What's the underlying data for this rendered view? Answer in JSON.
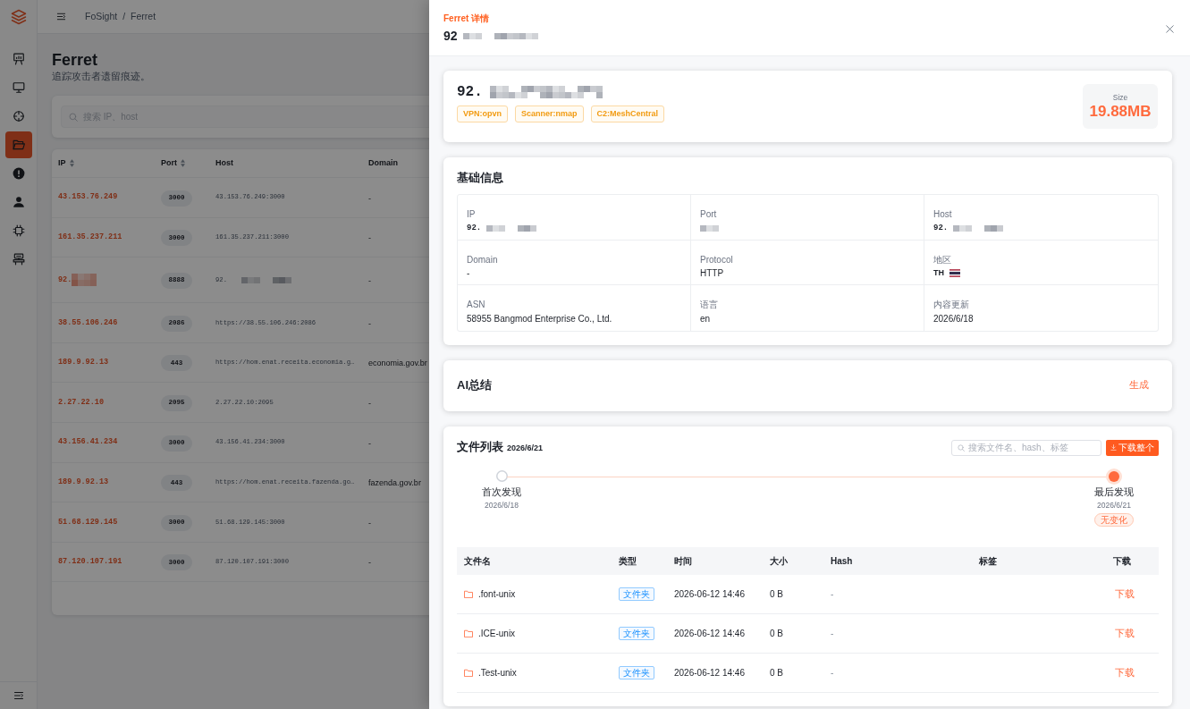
{
  "app": {
    "sidebar": {
      "items": [
        {
          "selected": false
        },
        {
          "selected": false
        },
        {
          "selected": false
        },
        {
          "selected": true
        },
        {
          "selected": false
        },
        {
          "selected": false
        },
        {
          "selected": false
        },
        {
          "selected": false
        }
      ]
    },
    "breadcrumb": {
      "items": [
        "FoSight",
        "Ferret"
      ],
      "separator": "/"
    },
    "page": {
      "title": "Ferret",
      "subtitle": "追踪攻击者遗留痕迹。"
    },
    "search": {
      "placeholder": "搜索 IP、host"
    },
    "table": {
      "columns": [
        {
          "label": "IP",
          "sortable": true
        },
        {
          "label": "Port",
          "sortable": true
        },
        {
          "label": "Host",
          "sortable": false
        },
        {
          "label": "Domain",
          "sortable": false
        }
      ],
      "rows": [
        {
          "ip": "43.153.76.249",
          "port": "3000",
          "host": "43.153.76.249:3000",
          "domain": "-",
          "redacted": false
        },
        {
          "ip": "161.35.237.211",
          "port": "3000",
          "host": "161.35.237.211:3000",
          "domain": "-",
          "redacted": false
        },
        {
          "ip": "92.",
          "port": "8888",
          "host": "92.",
          "domain": "-",
          "redacted": true
        },
        {
          "ip": "38.55.106.246",
          "port": "2086",
          "host": "https://38.55.106.246:2086",
          "domain": "-",
          "redacted": false
        },
        {
          "ip": "189.9.92.13",
          "port": "443",
          "host": "https://hom.enat.receita.economia.g…",
          "domain": "economia.gov.br",
          "redacted": false
        },
        {
          "ip": "2.27.22.10",
          "port": "2095",
          "host": "2.27.22.10:2095",
          "domain": "-",
          "redacted": false
        },
        {
          "ip": "43.156.41.234",
          "port": "3000",
          "host": "43.156.41.234:3000",
          "domain": "-",
          "redacted": false
        },
        {
          "ip": "189.9.92.13",
          "port": "443",
          "host": "https://hom.enat.receita.fazenda.go…",
          "domain": "fazenda.gov.br",
          "redacted": false
        },
        {
          "ip": "51.68.129.145",
          "port": "3000",
          "host": "51.68.129.145:3000",
          "domain": "-",
          "redacted": false
        },
        {
          "ip": "87.120.107.191",
          "port": "3000",
          "host": "87.120.107.191:3000",
          "domain": "-",
          "redacted": false
        }
      ]
    }
  },
  "drawer": {
    "eyebrow": "Ferret 详情",
    "title": {
      "text": "92",
      "redacted": true
    },
    "summary": {
      "ip": {
        "text": "92.",
        "redacted": true
      },
      "tags": [
        "VPN:opvn",
        "Scanner:nmap",
        "C2:MeshCentral"
      ],
      "size": {
        "label": "Size",
        "value": "19.88MB"
      }
    },
    "basic_info": {
      "title": "基础信息",
      "fields": [
        {
          "label": "IP",
          "kind": "mono",
          "value": "92.",
          "redacted": true
        },
        {
          "label": "Port",
          "kind": "mono",
          "redacted": true
        },
        {
          "label": "Host",
          "kind": "mono",
          "value": "92.",
          "redacted": true
        },
        {
          "label": "Domain",
          "kind": "text",
          "value": "-",
          "redacted": false
        },
        {
          "label": "Protocol",
          "kind": "text",
          "value": "HTTP",
          "redacted": false
        },
        {
          "label": "地区",
          "kind": "country",
          "value": "TH",
          "redacted": false
        },
        {
          "label": "ASN",
          "kind": "text",
          "value": "58955 Bangmod Enterprise Co., Ltd.",
          "redacted": false
        },
        {
          "label": "语言",
          "kind": "text",
          "value": "en",
          "redacted": false
        },
        {
          "label": "内容更新",
          "kind": "text",
          "value": "2026/6/18",
          "redacted": false
        }
      ]
    },
    "ai_summary": {
      "title": "AI总结",
      "action": "生成"
    },
    "files": {
      "title": "文件列表",
      "date": "2026/6/21",
      "search": {
        "placeholder": "搜索文件名、hash、标签"
      },
      "download_all": "下载整个",
      "timeline": [
        {
          "label": "首次发现",
          "date": "2026/6/18",
          "current": false
        },
        {
          "label": "最后发现",
          "date": "2026/6/21",
          "current": true,
          "status": "无变化"
        }
      ],
      "columns": [
        "文件名",
        "类型",
        "时间",
        "大小",
        "Hash",
        "标签",
        "下载"
      ],
      "rows": [
        {
          "kind": "folder",
          "name": ".font-unix",
          "type": "文件夹",
          "time": "2026-06-12 14:46",
          "size": "0 B",
          "hash": "-",
          "action": "下载"
        },
        {
          "kind": "folder",
          "name": ".ICE-unix",
          "type": "文件夹",
          "time": "2026-06-12 14:46",
          "size": "0 B",
          "hash": "-",
          "action": "下载"
        },
        {
          "kind": "folder",
          "name": ".Test-unix",
          "type": "文件夹",
          "time": "2026-06-12 14:46",
          "size": "0 B",
          "hash": "-",
          "action": "下载"
        }
      ]
    }
  }
}
